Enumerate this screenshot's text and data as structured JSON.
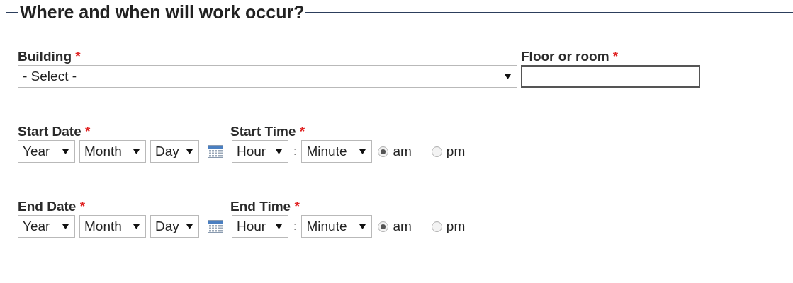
{
  "legend": "Where and when will work occur?",
  "building": {
    "label": "Building",
    "required_mark": "*",
    "value": "- Select -"
  },
  "floor_or_room": {
    "label": "Floor or room",
    "required_mark": "*"
  },
  "schedules": [
    {
      "date_label": "Start Date",
      "date_mark": "*",
      "date_selects": [
        "Year",
        "Month",
        "Day"
      ],
      "time_label": "Start Time",
      "time_mark": "*",
      "hour": "Hour",
      "separator": ":",
      "minute": "Minute",
      "periods": [
        {
          "label": "am",
          "selected": true
        },
        {
          "label": "pm",
          "selected": false
        }
      ]
    },
    {
      "date_label": "End Date",
      "date_mark": "*",
      "date_selects": [
        "Year",
        "Month",
        "Day"
      ],
      "time_label": "End Time",
      "time_mark": "*",
      "hour": "Hour",
      "separator": ":",
      "minute": "Minute",
      "periods": [
        {
          "label": "am",
          "selected": true
        },
        {
          "label": "pm",
          "selected": false
        }
      ]
    }
  ]
}
